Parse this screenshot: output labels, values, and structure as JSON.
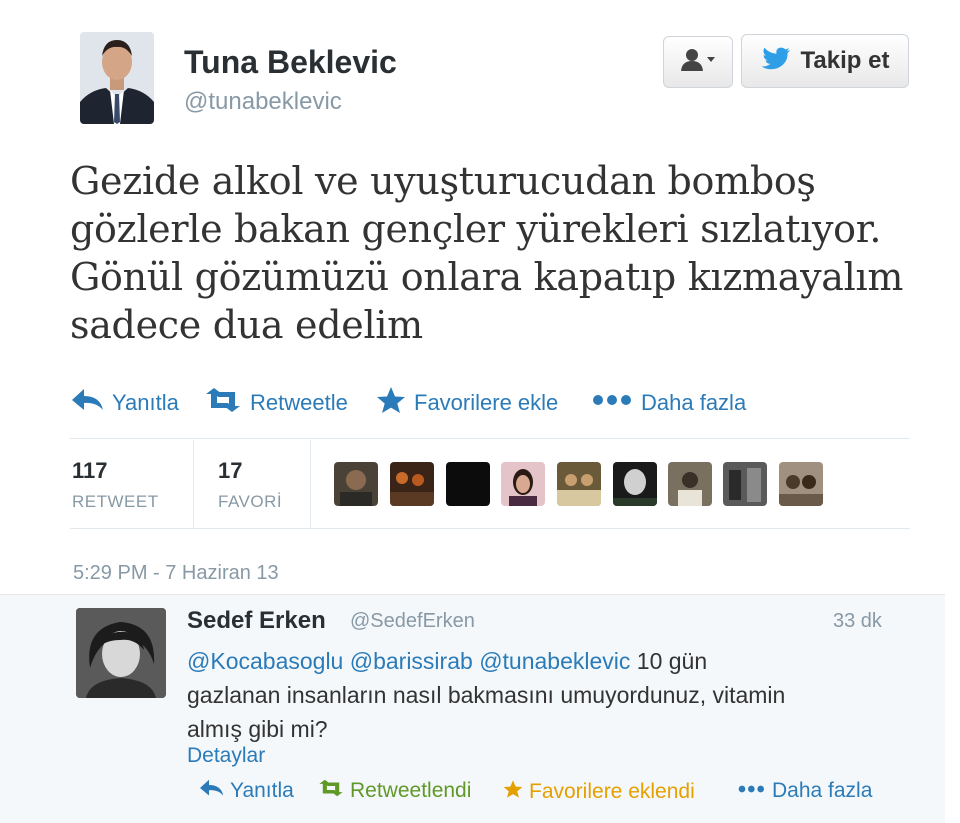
{
  "author": {
    "name": "Tuna Beklevic",
    "handle": "@tunabeklevic"
  },
  "follow_button": {
    "label": "Takip et",
    "icon": "twitter-bird-icon"
  },
  "user_menu_button": {
    "icon": "user-dropdown-icon"
  },
  "tweet": {
    "lines": [
      "Gezide alkol ve uyuşturucudan bomboş",
      "gözlerle bakan gençler yürekleri sızlatıyor.",
      "Gönül gözümüzü onlara kapatıp kızmayalım",
      "sadece dua edelim"
    ]
  },
  "actions": {
    "reply": "Yanıtla",
    "retweet": "Retweetle",
    "favorite": "Favorilere ekle",
    "more": "Daha fazla"
  },
  "stats": {
    "retweets": {
      "value": "117",
      "label": "RETWEET"
    },
    "favorites": {
      "value": "17",
      "label": "FAVORİ"
    }
  },
  "timestamp": "5:29 PM - 7 Haziran 13",
  "reply": {
    "name": "Sedef Erken",
    "handle": "@SedefErken",
    "time": "33 dk",
    "mentions": [
      "@Kocabasoglu",
      "@barissirab",
      "@tunabeklevic"
    ],
    "text_line1_rest": " 10 gün",
    "text_line2": "gazlanan insanların nasıl bakmasını umuyordunuz, vitamin",
    "text_line3": "almış gibi mi?",
    "details": "Detaylar",
    "actions": {
      "reply": "Yanıtla",
      "retweeted": "Retweetlendi",
      "favorited": "Favorilere eklendi",
      "more": "Daha fazla"
    }
  },
  "colors": {
    "link": "#2b7bb9",
    "retweeted": "#609928",
    "favorited": "#e5a000",
    "muted": "#8899a6"
  }
}
